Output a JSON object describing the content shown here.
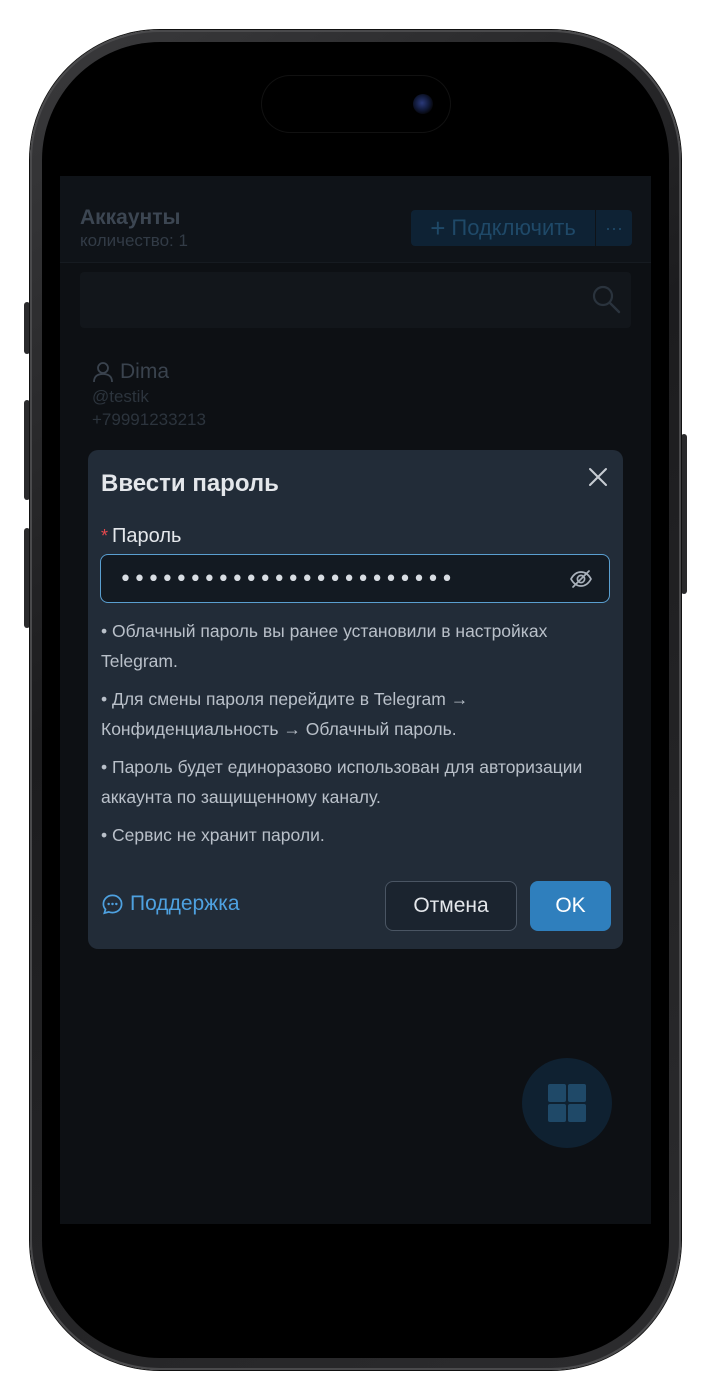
{
  "app": {
    "title": "Аккаунты",
    "count_text": "количество: 1",
    "connect_label": "Подключить",
    "more_label": "···",
    "search": {
      "placeholder": ""
    }
  },
  "accounts": [
    {
      "name": "Dima",
      "username": "@testik",
      "phone": "+79991233213"
    }
  ],
  "modal": {
    "title": "Ввести пароль",
    "field_label": "Пароль",
    "required_mark": "*",
    "password_value": "••••••••••••••••••••••••",
    "notes": [
      "• Облачный пароль вы ранее установили в настройках Telegram.",
      "• Для смены пароля перейдите в Telegram → Конфиденциальность → Облачный пароль.",
      "• Пароль будет единоразово использован для авторизации аккаунта по защищенному каналу.",
      "• Сервис не хранит пароли."
    ],
    "support_label": "Поддержка",
    "cancel_label": "Отмена",
    "ok_label": "OK"
  },
  "colors": {
    "accent": "#2f7fbd",
    "link": "#4ea1e0",
    "required": "#e5484d",
    "modal_bg": "#222c38"
  },
  "icons": [
    "close-icon",
    "eye-off-icon",
    "chat-bubble-icon",
    "search-icon",
    "user-icon",
    "grid-icon",
    "plus-icon"
  ]
}
